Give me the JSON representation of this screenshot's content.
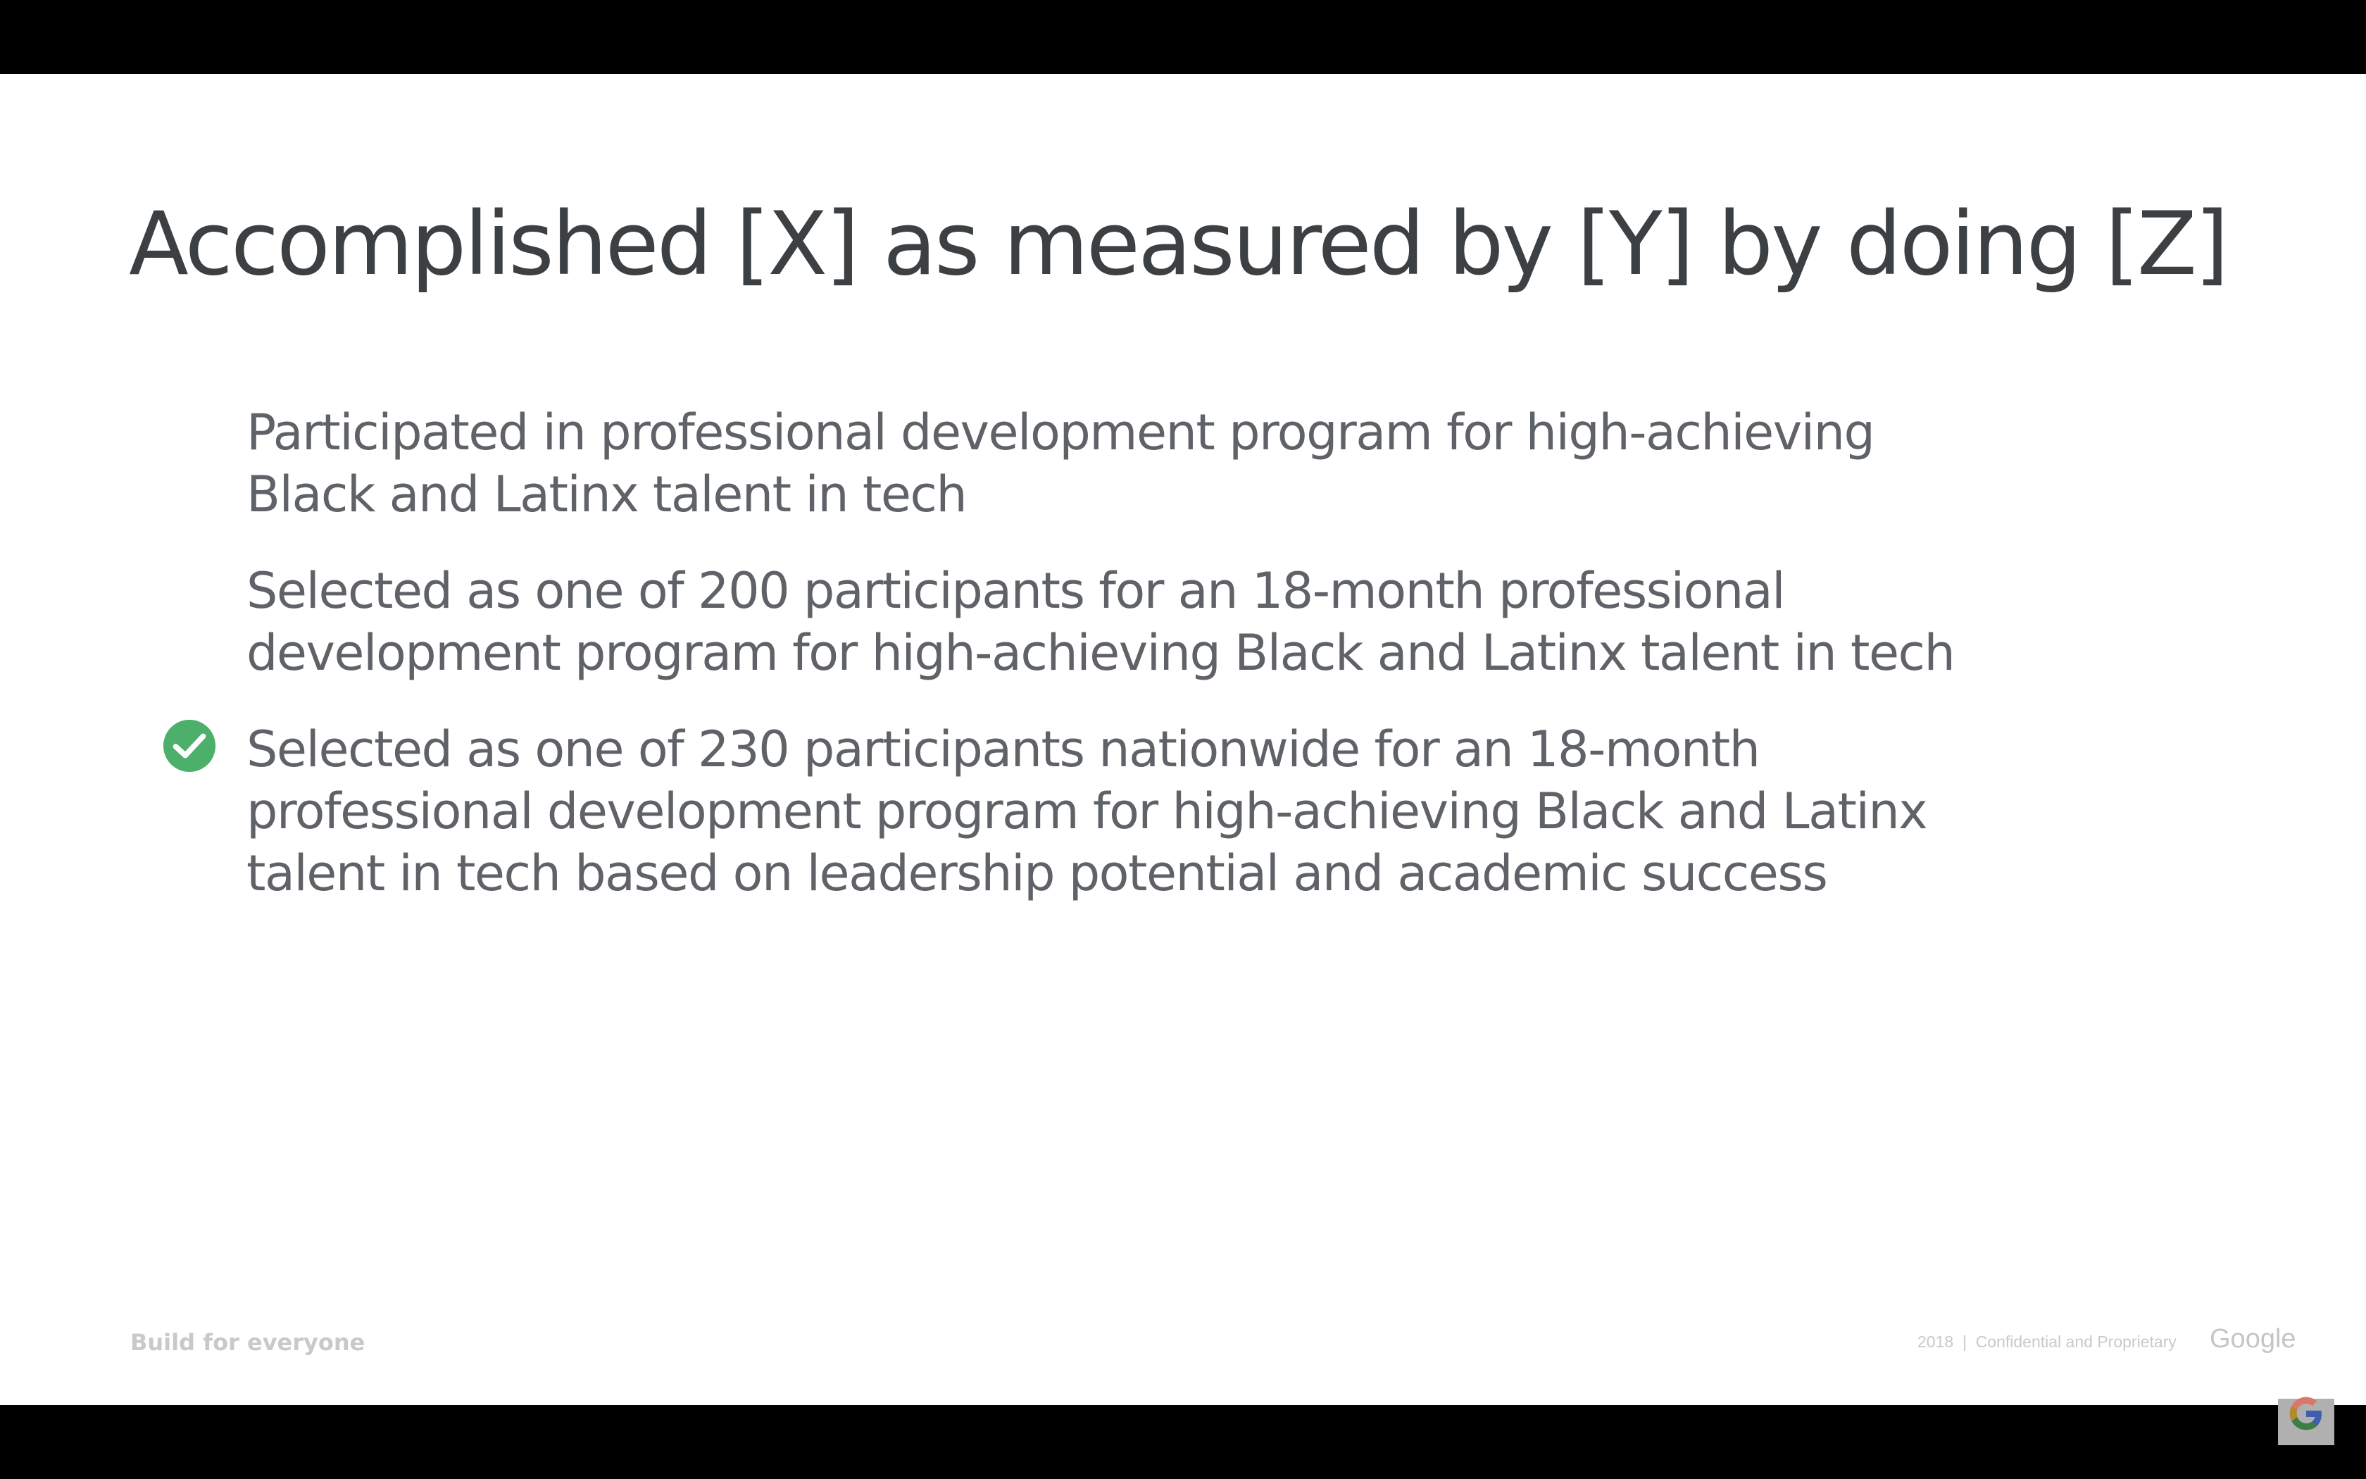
{
  "slide": {
    "title": "Accomplished [X] as measured by [Y] by doing [Z]",
    "items": [
      {
        "text": "Participated in professional development program for high-achieving Black and Latinx talent in tech",
        "checked": false
      },
      {
        "text": "Selected as one of 200 participants for an 18-month professional development program for high-achieving Black and Latinx talent in tech",
        "checked": false
      },
      {
        "text": "Selected as one of 230 participants nationwide for an 18-month professional development program for high-achieving Black and Latinx talent in tech based on leadership potential and academic success",
        "checked": true
      }
    ],
    "check_color": "#4caf6a"
  },
  "footer": {
    "tagline": "Build for everyone",
    "legal": "2018  |  Confidential and Proprietary",
    "brand": "Google"
  },
  "overlay": {
    "icon": "google-g-logo-icon"
  }
}
